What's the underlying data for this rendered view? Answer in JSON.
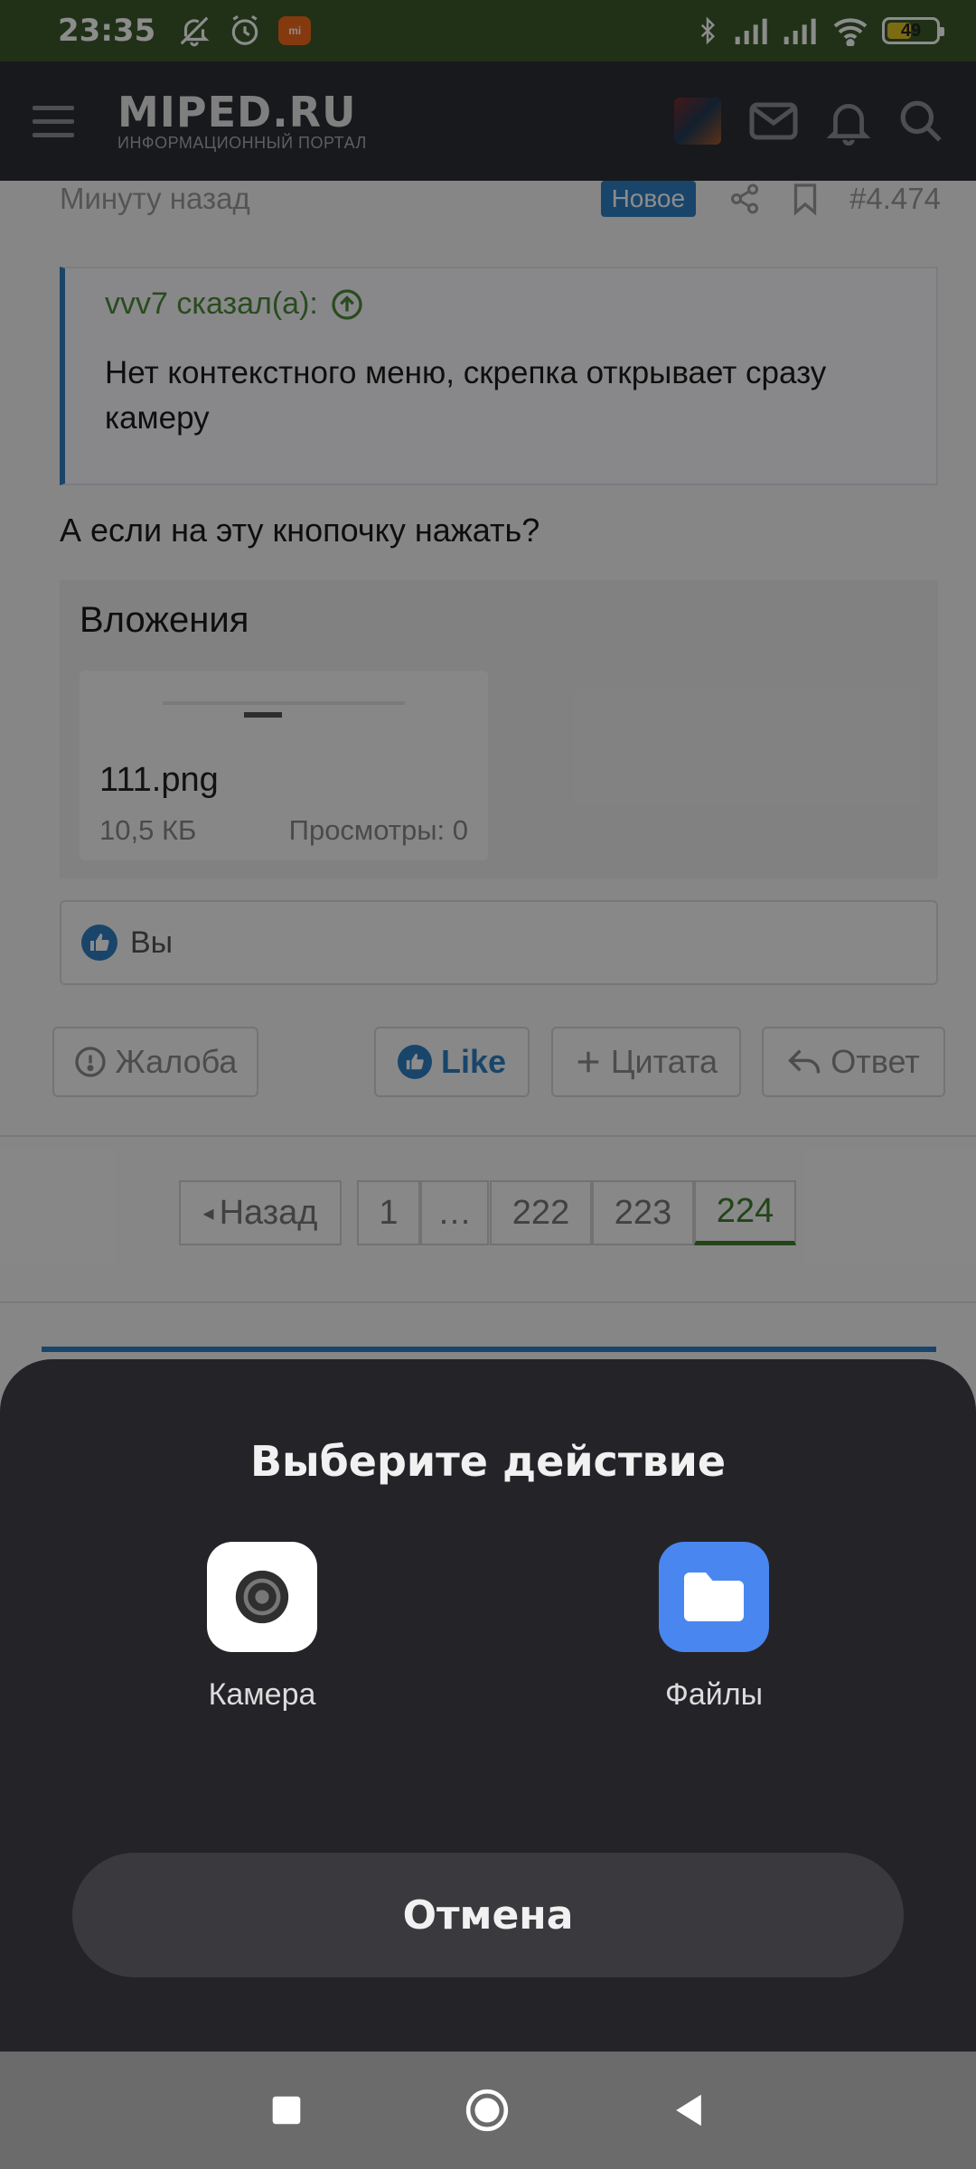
{
  "status_bar": {
    "time": "23:35",
    "mi_badge": "mi",
    "battery_level": "49",
    "battery_fraction": 0.49,
    "icons": [
      "mute-icon",
      "alarm-icon",
      "bluetooth-icon",
      "signal-icon",
      "signal-icon",
      "wifi-icon"
    ]
  },
  "header": {
    "logo_name": "MIPED.RU",
    "logo_subtitle": "ИНФОРМАЦИОННЫЙ ПОРТАЛ",
    "icons": [
      "menu-icon",
      "avatar",
      "mail-icon",
      "bell-icon",
      "search-icon"
    ]
  },
  "post": {
    "time": "Минуту назад",
    "new_badge": "Новое",
    "number": "#4.474",
    "quote_author": "vvv7 сказал(а):",
    "quote_text": "Нет контекстного меню, скрепка открывает сразу камеру",
    "text": "А если на эту кнопочку нажать?",
    "attachments_title": "Вложения",
    "attachment": {
      "file_name": "111.png",
      "size": "10,5 КБ",
      "views": "Просмотры: 0"
    },
    "likes_text": "Вы"
  },
  "actions": {
    "report": "Жалоба",
    "like": "Like",
    "quote": "Цитата",
    "reply": "Ответ"
  },
  "pagination": {
    "prev": "Назад",
    "pages": [
      "1",
      "…",
      "222",
      "223",
      "224"
    ],
    "current": "224"
  },
  "sheet": {
    "title": "Выберите действие",
    "options": [
      {
        "label": "Камера",
        "icon": "camera-icon"
      },
      {
        "label": "Файлы",
        "icon": "folder-icon"
      }
    ],
    "cancel": "Отмена"
  },
  "colors": {
    "status_bar": "#3b5a2a",
    "header_bg": "#2b2e34",
    "accent_blue": "#2f7fc2",
    "accent_green": "#3e7e2c",
    "sheet_bg": "#242428",
    "files_icon_bg": "#4a86f0"
  }
}
